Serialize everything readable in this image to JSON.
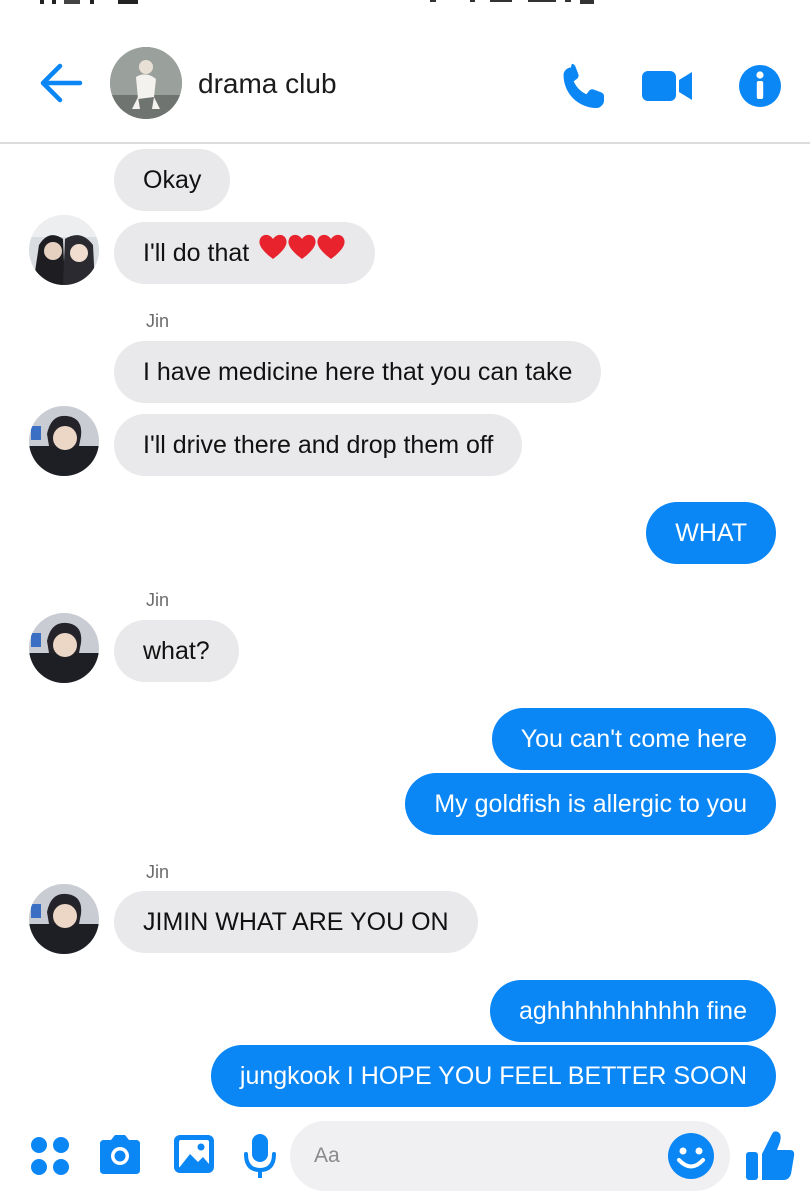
{
  "header": {
    "title": "drama club"
  },
  "input": {
    "placeholder": "Aa"
  },
  "colors": {
    "accent": "#0b86f5",
    "incoming_bubble": "#e9e9eb",
    "sender_text": "#6b6b6b"
  },
  "messages": [
    {
      "from": "incoming",
      "text": "Okay"
    },
    {
      "from": "incoming",
      "text": "I'll do that",
      "emoji": "three red hearts"
    },
    {
      "from": "incoming",
      "sender": "Jin",
      "text": "I have medicine here that you can take"
    },
    {
      "from": "incoming",
      "text": "I'll drive there and drop them off"
    },
    {
      "from": "outgoing",
      "text": "WHAT"
    },
    {
      "from": "incoming",
      "sender": "Jin",
      "text": "what?"
    },
    {
      "from": "outgoing",
      "text": "You can't come here"
    },
    {
      "from": "outgoing",
      "text": "My goldfish is allergic to you"
    },
    {
      "from": "incoming",
      "sender": "Jin",
      "text": "JIMIN WHAT ARE YOU ON"
    },
    {
      "from": "outgoing",
      "text": "aghhhhhhhhhhh fine"
    },
    {
      "from": "outgoing",
      "text": "jungkook I HOPE YOU FEEL BETTER SOON"
    }
  ],
  "icons": [
    "back-arrow-icon",
    "phone-icon",
    "video-camera-icon",
    "info-icon",
    "apps-grid-icon",
    "camera-icon",
    "gallery-icon",
    "microphone-icon",
    "emoji-icon",
    "thumbs-up-icon"
  ]
}
